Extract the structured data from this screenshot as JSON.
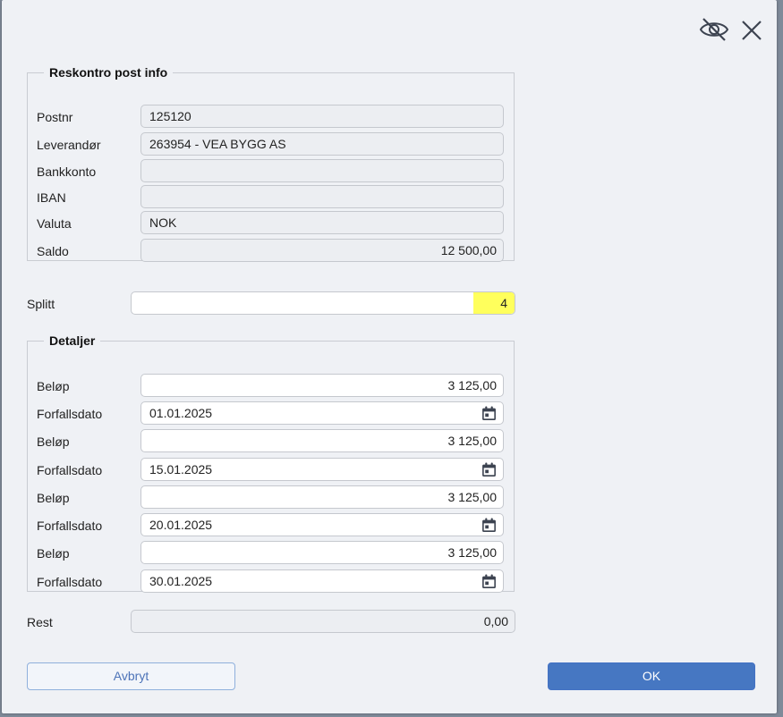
{
  "header": {
    "hide_icon": "eye-slash-icon",
    "close_icon": "close-icon"
  },
  "reskontro": {
    "legend": "Reskontro post info",
    "fields": [
      {
        "label": "Postnr",
        "value": "125120"
      },
      {
        "label": "Leverandør",
        "value": "263954 - VEA BYGG AS"
      },
      {
        "label": "Bankkonto",
        "value": ""
      },
      {
        "label": "IBAN",
        "value": ""
      },
      {
        "label": "Valuta",
        "value": "NOK"
      },
      {
        "label": "Saldo",
        "value": "12 500,00"
      }
    ]
  },
  "splitt": {
    "label": "Splitt",
    "value": "4",
    "highlight_color": "#ffff5c"
  },
  "detaljer": {
    "legend": "Detaljer",
    "entries": [
      {
        "amount_label": "Beløp",
        "amount": "3 125,00",
        "date_label": "Forfallsdato",
        "date": "01.01.2025"
      },
      {
        "amount_label": "Beløp",
        "amount": "3 125,00",
        "date_label": "Forfallsdato",
        "date": "15.01.2025"
      },
      {
        "amount_label": "Beløp",
        "amount": "3 125,00",
        "date_label": "Forfallsdato",
        "date": "20.01.2025"
      },
      {
        "amount_label": "Beløp",
        "amount": "3 125,00",
        "date_label": "Forfallsdato",
        "date": "30.01.2025"
      }
    ]
  },
  "rest": {
    "label": "Rest",
    "value": "0,00"
  },
  "buttons": {
    "cancel_label": "Avbryt",
    "ok_label": "OK",
    "ok_color": "#4677c2"
  }
}
